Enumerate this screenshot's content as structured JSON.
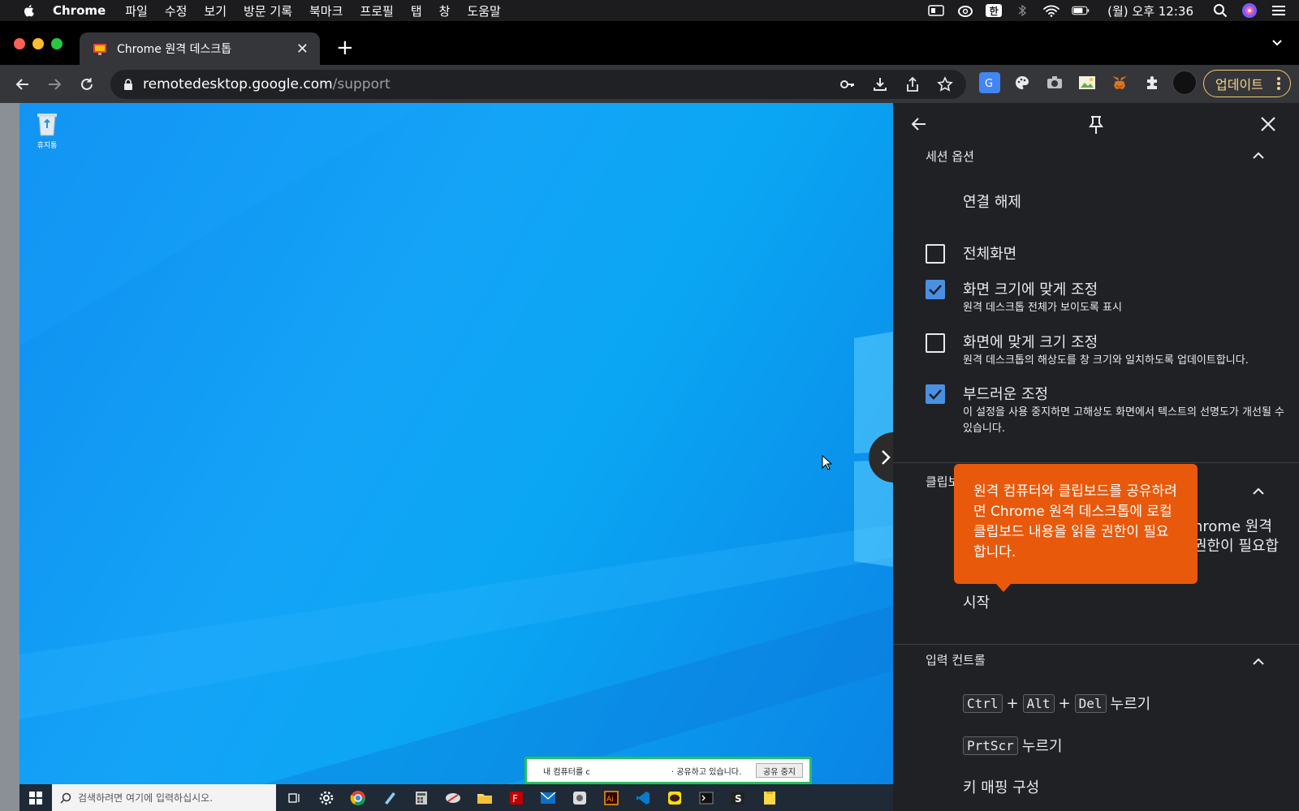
{
  "menubar": {
    "app_name": "Chrome",
    "items": [
      "파일",
      "수정",
      "보기",
      "방문 기록",
      "북마크",
      "프로필",
      "탭",
      "창",
      "도움말"
    ],
    "input_method": "한",
    "clock": "(월) 오후 12:36"
  },
  "tab": {
    "title": "Chrome 원격 데스크톱",
    "close_label": "✕"
  },
  "toolbar": {
    "url_host": "remotedesktop.google.com",
    "url_path": "/support",
    "update_label": "업데이트"
  },
  "remote": {
    "recycle_label": "휴지통",
    "share_banner_text": "내 컴퓨터를 c",
    "share_banner_text2": "· 공유하고 있습니다.",
    "stop_share_label": "공유 중지",
    "taskbar_search_placeholder": "검색하려면 여기에 입력하십시오."
  },
  "panel": {
    "session_section": "세션 옵션",
    "disconnect": "연결 해제",
    "options": [
      {
        "label": "전체화면",
        "checked": false,
        "sub": ""
      },
      {
        "label": "화면 크기에 맞게 조정",
        "checked": true,
        "sub": "원격 데스크톱 전체가 보이도록 표시"
      },
      {
        "label": "화면에 맞게 크기 조정",
        "checked": false,
        "sub": "원격 데스크톱의 해상도를 창 크기와 일치하도록 업데이트합니다."
      },
      {
        "label": "부드러운 조정",
        "checked": true,
        "sub": "이 설정을 사용 중지하면 고해상도 화면에서 텍스트의 선명도가 개선될 수 있습니다."
      }
    ],
    "clipboard_section": "클립보드",
    "clipboard_partial1": "hrome 원격",
    "clipboard_partial2": "권한이 필요합",
    "start": "시작",
    "input_section": "입력 컨트롤",
    "cad_keys": [
      "Ctrl",
      "Alt",
      "Del"
    ],
    "plus": "+",
    "press_label": "누르기",
    "prtscr_key": "PrtScr",
    "keymap_label": "키 매핑 구성"
  },
  "tooltip": {
    "text": "원격 컴퓨터와 클립보드를 공유하려면 Chrome 원격 데스크톱에 로컬 클립보드 내용을 읽을 권한이 필요합니다."
  }
}
